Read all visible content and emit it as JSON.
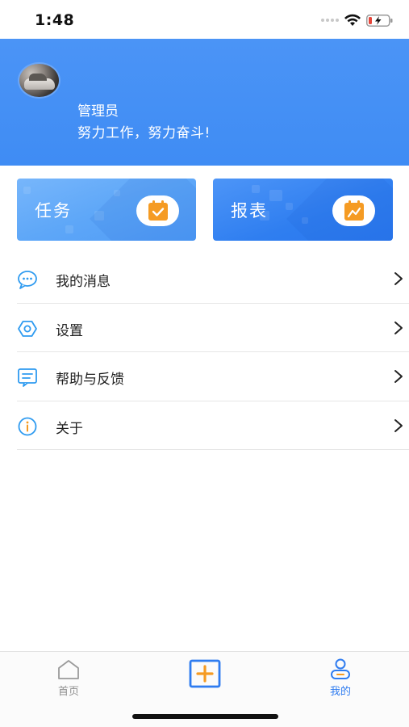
{
  "status_bar": {
    "time": "1:48"
  },
  "profile": {
    "name": "管理员",
    "motto": "努力工作，努力奋斗!"
  },
  "cards": [
    {
      "label": "任务",
      "icon": "calendar-check-icon",
      "accent": "#f59b23"
    },
    {
      "label": "报表",
      "icon": "chart-trend-icon",
      "accent": "#f59b23"
    }
  ],
  "menu": {
    "items": [
      {
        "label": "我的消息",
        "icon": "message-bubble-icon"
      },
      {
        "label": "设置",
        "icon": "settings-hexagon-icon"
      },
      {
        "label": "帮助与反馈",
        "icon": "feedback-icon"
      },
      {
        "label": "关于",
        "icon": "info-icon"
      }
    ]
  },
  "tab_bar": {
    "home_label": "首页",
    "mine_label": "我的",
    "active": "mine"
  },
  "colors": {
    "primary": "#3f8cf4",
    "accent": "#f59b23",
    "active_tab": "#2f7cf0",
    "inactive_tab": "#8e8e8e"
  }
}
